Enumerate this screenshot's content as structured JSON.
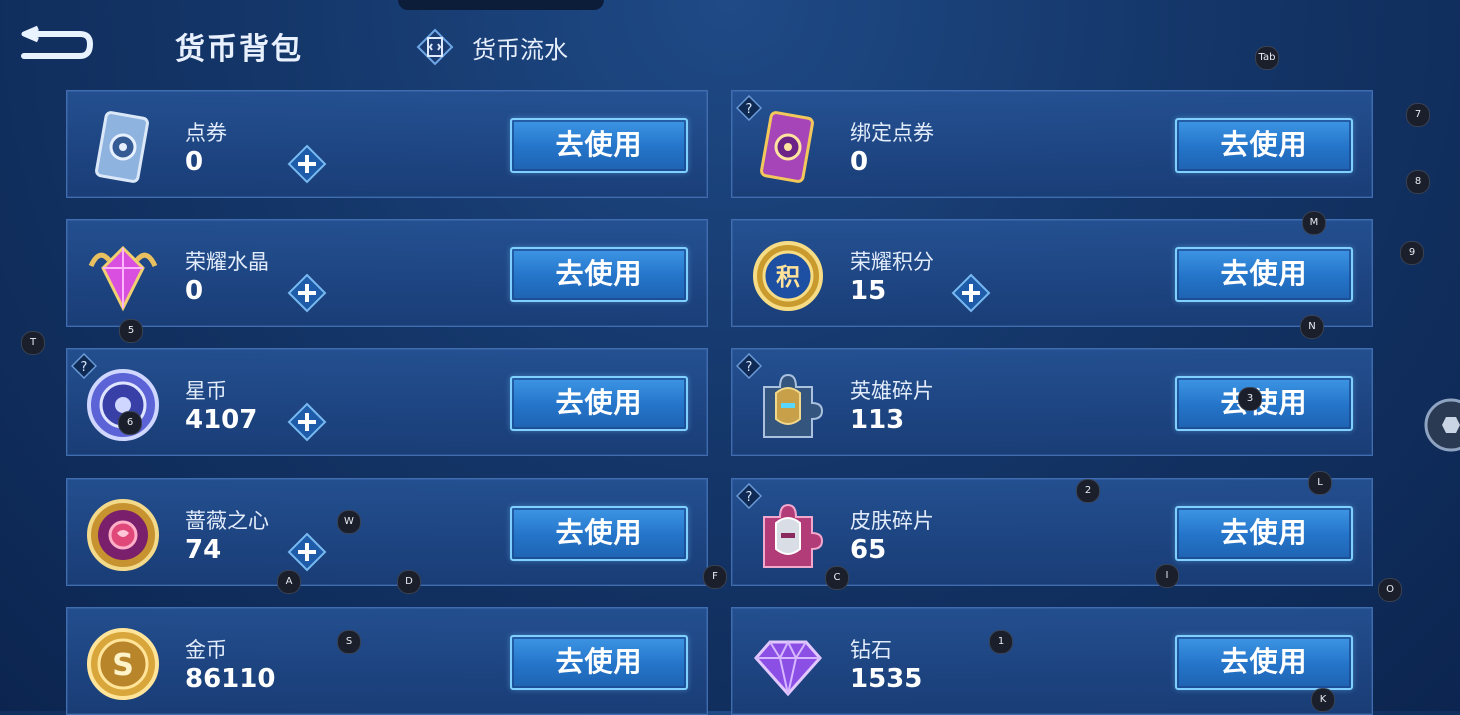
{
  "header": {
    "title": "货币背包",
    "flow_label": "货币流水"
  },
  "use_label": "去使用",
  "cards": [
    {
      "name": "点券",
      "amount": "0"
    },
    {
      "name": "绑定点券",
      "amount": "0"
    },
    {
      "name": "荣耀水晶",
      "amount": "0"
    },
    {
      "name": "荣耀积分",
      "amount": "15"
    },
    {
      "name": "星币",
      "amount": "4107"
    },
    {
      "name": "英雄碎片",
      "amount": "113"
    },
    {
      "name": "蔷薇之心",
      "amount": "74"
    },
    {
      "name": "皮肤碎片",
      "amount": "65"
    },
    {
      "name": "金币",
      "amount": "86110"
    },
    {
      "name": "钻石",
      "amount": "1535"
    }
  ],
  "key_hints": [
    "Tab",
    "7",
    "8",
    "M",
    "9",
    "5",
    "T",
    "N",
    "6",
    "3",
    "2",
    "L",
    "W",
    "A",
    "D",
    "F",
    "C",
    "I",
    "O",
    "S",
    "1",
    "K"
  ],
  "colors": {
    "button_top": "#3d95e4",
    "button_border": "#7fd0ff",
    "card_bg": "#1f4a8a"
  }
}
